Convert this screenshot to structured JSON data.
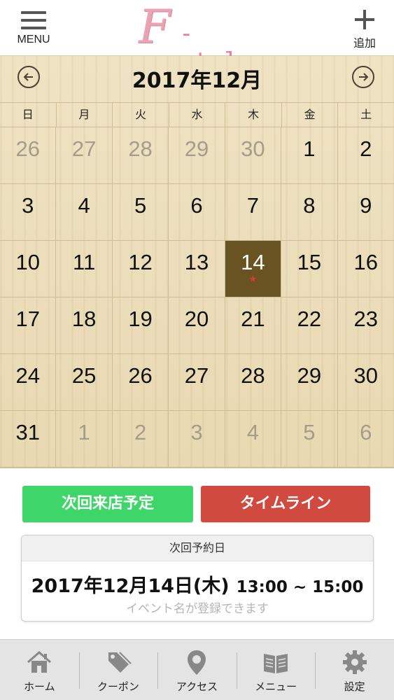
{
  "header": {
    "menu_label": "MENU",
    "logo_letter": "F",
    "logo_rest": "-style",
    "add_label": "追加"
  },
  "calendar": {
    "title": "2017年12月",
    "weekdays": [
      "日",
      "月",
      "火",
      "水",
      "木",
      "金",
      "土"
    ],
    "days": [
      {
        "n": "26",
        "other": true
      },
      {
        "n": "27",
        "other": true
      },
      {
        "n": "28",
        "other": true
      },
      {
        "n": "29",
        "other": true
      },
      {
        "n": "30",
        "other": true
      },
      {
        "n": "1"
      },
      {
        "n": "2"
      },
      {
        "n": "3"
      },
      {
        "n": "4"
      },
      {
        "n": "5"
      },
      {
        "n": "6"
      },
      {
        "n": "7"
      },
      {
        "n": "8"
      },
      {
        "n": "9"
      },
      {
        "n": "10"
      },
      {
        "n": "11"
      },
      {
        "n": "12"
      },
      {
        "n": "13"
      },
      {
        "n": "14",
        "today": true,
        "mark": "★"
      },
      {
        "n": "15"
      },
      {
        "n": "16"
      },
      {
        "n": "17"
      },
      {
        "n": "18"
      },
      {
        "n": "19"
      },
      {
        "n": "20"
      },
      {
        "n": "21"
      },
      {
        "n": "22"
      },
      {
        "n": "23"
      },
      {
        "n": "24"
      },
      {
        "n": "25"
      },
      {
        "n": "26"
      },
      {
        "n": "27"
      },
      {
        "n": "28"
      },
      {
        "n": "29"
      },
      {
        "n": "30"
      },
      {
        "n": "31"
      },
      {
        "n": "1",
        "other": true
      },
      {
        "n": "2",
        "other": true
      },
      {
        "n": "3",
        "other": true
      },
      {
        "n": "4",
        "other": true
      },
      {
        "n": "5",
        "other": true
      },
      {
        "n": "6",
        "other": true
      }
    ]
  },
  "buttons": {
    "next_visit": "次回来店予定",
    "timeline": "タイムライン"
  },
  "reservation": {
    "header": "次回予約日",
    "date": "2017年12月14日(木)",
    "time": "13:00 ~ 15:00",
    "note": "イベント名が登録できます"
  },
  "tabs": [
    {
      "label": "ホーム",
      "icon": "home-icon"
    },
    {
      "label": "クーポン",
      "icon": "tag-icon"
    },
    {
      "label": "アクセス",
      "icon": "map-pin-icon"
    },
    {
      "label": "メニュー",
      "icon": "book-icon"
    },
    {
      "label": "設定",
      "icon": "gear-icon"
    }
  ],
  "colors": {
    "accent_green": "#3fd669",
    "accent_red": "#d04a40",
    "today_bg": "#6a5322",
    "logo_pink": "#e77f9d"
  }
}
